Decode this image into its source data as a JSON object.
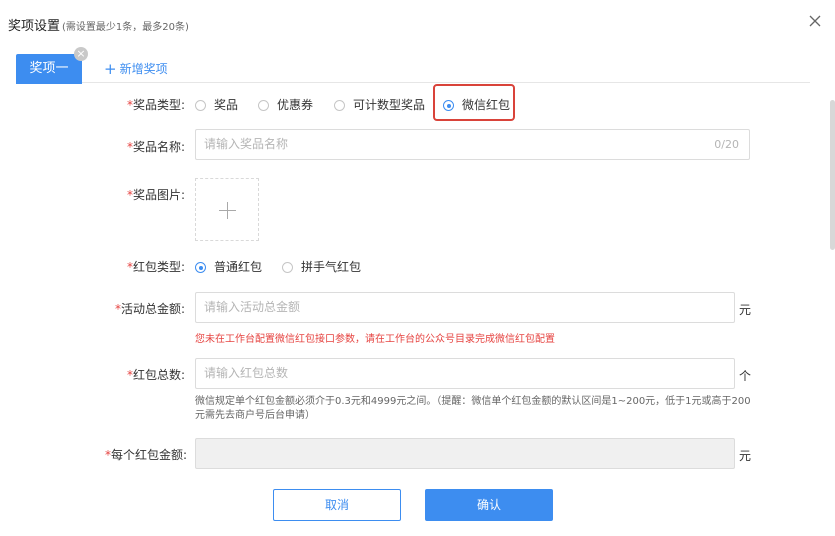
{
  "dialog": {
    "title": "奖项设置",
    "title_note": "(需设置最少1条，最多20条)"
  },
  "tabs": {
    "active_label": "奖项一",
    "remove_symbol": "×",
    "add_label": "新增奖项",
    "add_symbol": "+"
  },
  "form": {
    "required_mark": "*",
    "prize_type": {
      "label": "奖品类型:",
      "options": [
        "奖品",
        "优惠券",
        "可计数型奖品",
        "微信红包"
      ],
      "selected": "微信红包"
    },
    "prize_name": {
      "label": "奖品名称:",
      "placeholder": "请输入奖品名称",
      "count": "0/20"
    },
    "prize_image": {
      "label": "奖品图片:"
    },
    "red_packet_type": {
      "label": "红包类型:",
      "options": [
        "普通红包",
        "拼手气红包"
      ],
      "selected": "普通红包"
    },
    "total_amount": {
      "label": "活动总金额:",
      "placeholder": "请输入活动总金额",
      "unit": "元",
      "warning": "您未在工作台配置微信红包接口参数，请在工作台的公众号目录完成微信红包配置"
    },
    "packet_count": {
      "label": "红包总数:",
      "placeholder": "请输入红包总数",
      "unit": "个",
      "hint": "微信规定单个红包金额必须介于0.3元和4999元之间。（提醒：微信单个红包金额的默认区间是1~200元，低于1元或高于200元需先去商户号后台申请）"
    },
    "per_amount": {
      "label": "每个红包金额:",
      "unit": "元"
    }
  },
  "buttons": {
    "cancel": "取消",
    "confirm": "确认"
  },
  "colors": {
    "accent": "#3d8df0",
    "required": "#e64340",
    "highlight_box": "#d9433a"
  }
}
